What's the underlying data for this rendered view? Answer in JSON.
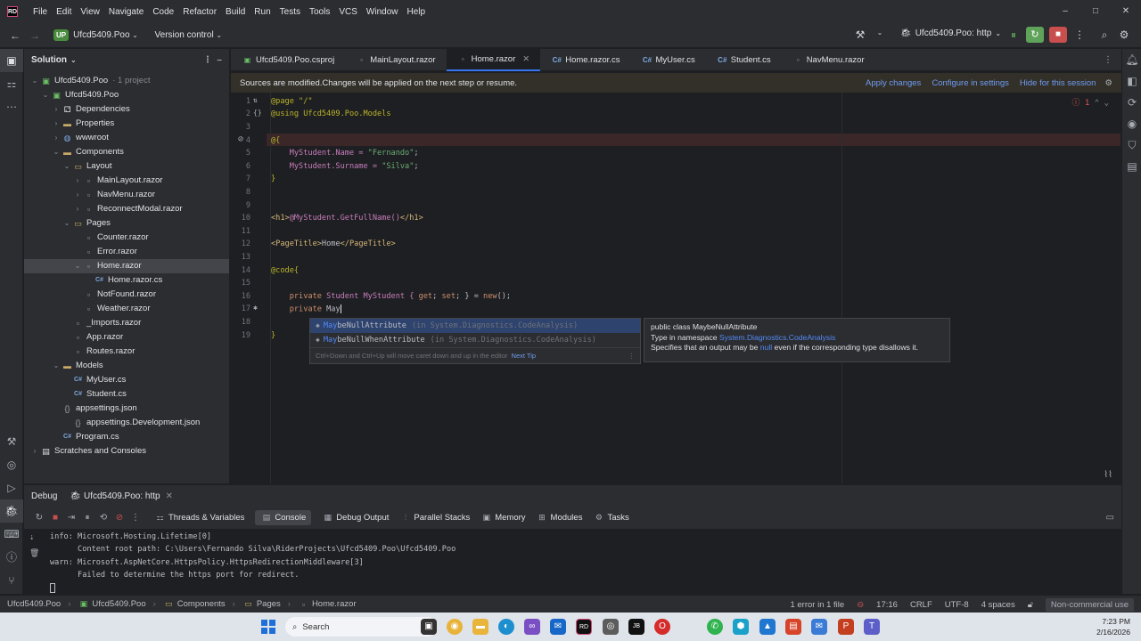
{
  "menu": [
    "File",
    "Edit",
    "View",
    "Navigate",
    "Code",
    "Refactor",
    "Build",
    "Run",
    "Tests",
    "Tools",
    "VCS",
    "Window",
    "Help"
  ],
  "toolbar": {
    "project_badge": "UP",
    "project_name": "Ufcd5409.Poo",
    "vcs": "Version control",
    "run_config": "Ufcd5409.Poo: http"
  },
  "solution": {
    "title": "Solution",
    "root": "Ufcd5409.Poo",
    "root_note": "· 1 project",
    "items": {
      "project": "Ufcd5409.Poo",
      "dependencies": "Dependencies",
      "properties": "Properties",
      "wwwroot": "wwwroot",
      "components": "Components",
      "layout": "Layout",
      "mainlayout": "MainLayout.razor",
      "navmenu": "NavMenu.razor",
      "reconnect": "ReconnectModal.razor",
      "pages": "Pages",
      "counter": "Counter.razor",
      "error": "Error.razor",
      "home": "Home.razor",
      "home_cs": "Home.razor.cs",
      "notfound": "NotFound.razor",
      "weather": "Weather.razor",
      "imports": "_Imports.razor",
      "app": "App.razor",
      "routes": "Routes.razor",
      "models": "Models",
      "myuser": "MyUser.cs",
      "student": "Student.cs",
      "appsettings": "appsettings.json",
      "appsettings_dev": "appsettings.Development.json",
      "program": "Program.cs",
      "scratches": "Scratches and Consoles"
    }
  },
  "tabs": [
    "Ufcd5409.Poo.csproj",
    "MainLayout.razor",
    "Home.razor",
    "Home.razor.cs",
    "MyUser.cs",
    "Student.cs",
    "NavMenu.razor"
  ],
  "notice": {
    "text": "Sources are modified.Changes will be applied on the next step or resume.",
    "apply": "Apply changes",
    "configure": "Configure in settings",
    "hide": "Hide for this session"
  },
  "editor": {
    "error_count": "1",
    "line_numbers": [
      "1",
      "2",
      "3",
      "4",
      "5",
      "6",
      "7",
      "8",
      "9",
      "10",
      "11",
      "12",
      "13",
      "14",
      "15",
      "16",
      "17",
      "18",
      "19"
    ],
    "lines": {
      "l1": "@page \"/\"",
      "l2": "@using Ufcd5409.Poo.Models",
      "l4": "@{",
      "l5a": "    MyStudent.Name = ",
      "l5b": "\"Fernando\"",
      "l5c": ";",
      "l6a": "    MyStudent.Surname = ",
      "l6b": "\"Silva\"",
      "l6c": ";",
      "l7": "}",
      "l10a": "<h1>",
      "l10b": "@MyStudent.GetFullName()",
      "l10c": "</h1>",
      "l12a": "<PageTitle>",
      "l12b": "Home",
      "l12c": "</PageTitle>",
      "l14": "@code{",
      "l16a": "    private ",
      "l16b": "Student",
      "l16c": " MyStudent { ",
      "l16d": "get",
      "l16e": "; ",
      "l16f": "set",
      "l16g": "; } = ",
      "l16h": "new",
      "l16i": "();",
      "l17a": "    private ",
      "l17b": "May",
      "l19": "}"
    }
  },
  "completion": {
    "item1_match": "May",
    "item1_rest": "beNullAttribute",
    "item1_ns": "(in System.Diagnostics.CodeAnalysis)",
    "item2_match": "May",
    "item2_rest": "beNullWhenAttribute",
    "item2_ns": "(in System.Diagnostics.CodeAnalysis)",
    "hint": "Ctrl+Down and Ctrl+Up will move caret down and up in the editor",
    "next_tip": "Next Tip"
  },
  "doc": {
    "line1_a": "public class ",
    "line1_b": "MaybeNullAttribute",
    "line2_a": "Type in namespace ",
    "line2_b": "System.Diagnostics.CodeAnalysis",
    "line3_a": "Specifies that an output may be ",
    "line3_b": "null",
    "line3_c": " even if the corresponding type disallows it."
  },
  "debug": {
    "title": "Debug",
    "session": "Ufcd5409.Poo: http",
    "tabs": [
      "Threads & Variables",
      "Console",
      "Debug Output",
      "Parallel Stacks",
      "Memory",
      "Modules",
      "Tasks"
    ],
    "console": [
      {
        "level": "info:",
        "text": " Microsoft.Hosting.Lifetime[0]"
      },
      {
        "level": "",
        "text": "      Content root path: C:\\Users\\Fernando Silva\\RiderProjects\\Ufcd5409.Poo\\Ufcd5409.Poo"
      },
      {
        "level": "warn:",
        "text": " Microsoft.AspNetCore.HttpsPolicy.HttpsRedirectionMiddleware[3]"
      },
      {
        "level": "",
        "text": "      Failed to determine the https port for redirect."
      }
    ]
  },
  "status": {
    "crumbs": [
      "Ufcd5409.Poo",
      "Ufcd5409.Poo",
      "Components",
      "Pages",
      "Home.razor"
    ],
    "errors": "1 error in 1 file",
    "position": "17:16",
    "line_sep": "CRLF",
    "encoding": "UTF-8",
    "indent": "4 spaces",
    "license": "Non-commercial use"
  },
  "taskbar": {
    "search": "Search",
    "time": "7:23 PM",
    "date": "2/16/2026"
  }
}
